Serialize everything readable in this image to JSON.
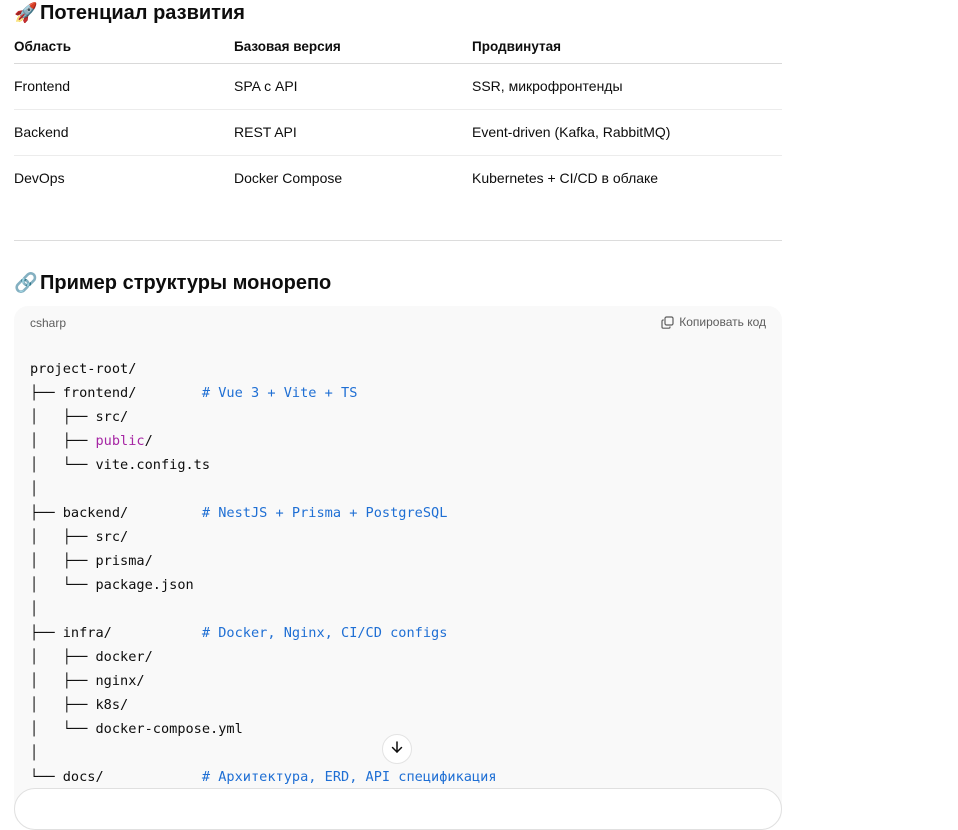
{
  "section_potential": {
    "emoji": "🚀",
    "title": "Потенциал развития"
  },
  "table": {
    "headers": [
      "Область",
      "Базовая версия",
      "Продвинутая"
    ],
    "rows": [
      [
        "Frontend",
        "SPA с API",
        "SSR, микрофронтенды"
      ],
      [
        "Backend",
        "REST API",
        "Event-driven (Kafka, RabbitMQ)"
      ],
      [
        "DevOps",
        "Docker Compose",
        "Kubernetes + CI/CD в облаке"
      ]
    ]
  },
  "section_monorepo": {
    "emoji": "🔗",
    "title": "Пример структуры монорепо"
  },
  "code_block": {
    "language": "csharp",
    "copy_label": "Копировать код",
    "lines": [
      [
        {
          "t": "project-root/"
        }
      ],
      [
        {
          "t": "├── frontend/        "
        },
        {
          "t": "# Vue 3 + Vite + TS",
          "c": "cm"
        }
      ],
      [
        {
          "t": "│   ├── src/"
        }
      ],
      [
        {
          "t": "│   ├── "
        },
        {
          "t": "public",
          "c": "kw"
        },
        {
          "t": "/"
        }
      ],
      [
        {
          "t": "│   └── vite.config.ts"
        }
      ],
      [
        {
          "t": "│"
        }
      ],
      [
        {
          "t": "├── backend/         "
        },
        {
          "t": "# NestJS + Prisma + PostgreSQL",
          "c": "cm"
        }
      ],
      [
        {
          "t": "│   ├── src/"
        }
      ],
      [
        {
          "t": "│   ├── prisma/"
        }
      ],
      [
        {
          "t": "│   └── package.json"
        }
      ],
      [
        {
          "t": "│"
        }
      ],
      [
        {
          "t": "├── infra/           "
        },
        {
          "t": "# Docker, Nginx, CI/CD configs",
          "c": "cm"
        }
      ],
      [
        {
          "t": "│   ├── docker/"
        }
      ],
      [
        {
          "t": "│   ├── nginx/"
        }
      ],
      [
        {
          "t": "│   ├── k8s/"
        }
      ],
      [
        {
          "t": "│   └── docker-compose.yml"
        }
      ],
      [
        {
          "t": "│"
        }
      ],
      [
        {
          "t": "└── docs/            "
        },
        {
          "t": "# Архитектура, ERD, API спецификация",
          "c": "cm"
        }
      ]
    ]
  },
  "icons": {
    "copy": "copy-icon",
    "scroll_down": "arrow-down-icon"
  }
}
